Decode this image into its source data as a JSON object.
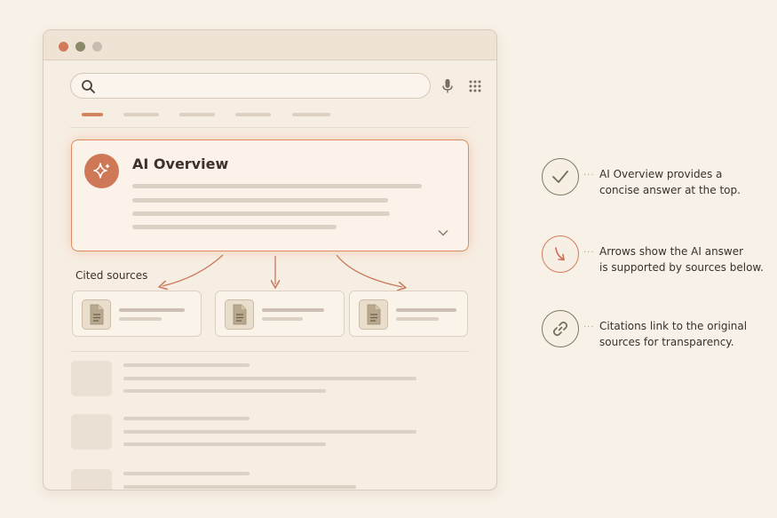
{
  "window": {
    "traffic_lights": [
      {
        "name": "close",
        "color": "#d07a5a"
      },
      {
        "name": "minimize",
        "color": "#8a8a66"
      },
      {
        "name": "maximize",
        "color": "#c8bcb0"
      }
    ]
  },
  "search": {
    "value": "",
    "placeholder": "",
    "icons": [
      "search-icon",
      "mic-icon",
      "apps-grid-icon"
    ]
  },
  "tabs": [
    {
      "active": true
    },
    {
      "active": false
    },
    {
      "active": false
    },
    {
      "active": false
    },
    {
      "active": false
    }
  ],
  "ai_overview": {
    "title": "AI Overview",
    "icon": "sparkle-icon",
    "expand_icon": "chevron-down-icon"
  },
  "cited_sources": {
    "label": "Cited sources",
    "items": [
      {
        "icon": "document-icon"
      },
      {
        "icon": "document-icon"
      },
      {
        "icon": "document-icon"
      }
    ]
  },
  "annotations": [
    {
      "icon": "checkmark-icon",
      "text_line1": "AI Overview provides a",
      "text_line2": "concise answer at the top."
    },
    {
      "icon": "curved-arrow-icon",
      "text_line1": "Arrows show the AI answer",
      "text_line2": "is supported by sources below."
    },
    {
      "icon": "link-icon",
      "text_line1": "Citations link to the original",
      "text_line2": "sources for transparency."
    }
  ],
  "colors": {
    "accent": "#d07a5a",
    "olive": "#7b7a63",
    "background": "#f8f1e7"
  }
}
